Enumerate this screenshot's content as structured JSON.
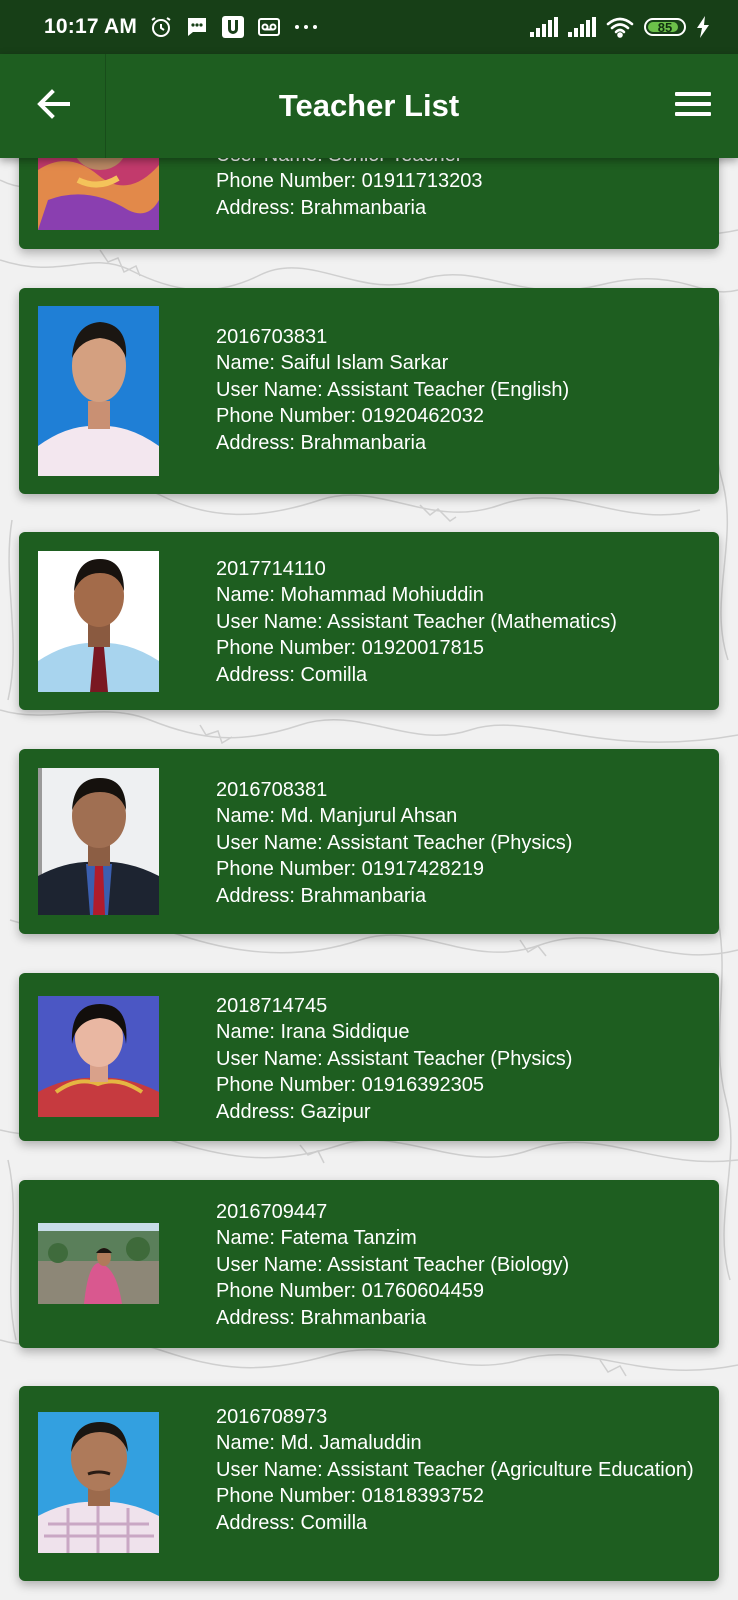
{
  "status_bar": {
    "time": "10:17 AM",
    "battery": "85"
  },
  "app_bar": {
    "title": "Teacher List"
  },
  "teachers": [
    {
      "id": "",
      "name": "",
      "user_name": "User Name: Senior Teacher",
      "phone": "Phone Number: 01911713203",
      "address": "Address: Brahmanbaria"
    },
    {
      "id": "2016703831",
      "name": "Name: Saiful Islam Sarkar",
      "user_name": "User Name: Assistant Teacher (English)",
      "phone": "Phone Number: 01920462032",
      "address": "Address: Brahmanbaria"
    },
    {
      "id": "2017714110",
      "name": "Name: Mohammad Mohiuddin",
      "user_name": "User Name: Assistant Teacher (Mathematics)",
      "phone": "Phone Number: 01920017815",
      "address": "Address: Comilla"
    },
    {
      "id": "2016708381",
      "name": "Name: Md. Manjurul Ahsan",
      "user_name": "User Name: Assistant Teacher (Physics)",
      "phone": "Phone Number: 01917428219",
      "address": "Address: Brahmanbaria"
    },
    {
      "id": "2018714745",
      "name": "Name: Irana Siddique",
      "user_name": "User Name: Assistant Teacher (Physics)",
      "phone": "Phone Number: 01916392305",
      "address": "Address: Gazipur"
    },
    {
      "id": "2016709447",
      "name": "Name: Fatema Tanzim",
      "user_name": "User Name: Assistant Teacher (Biology)",
      "phone": "Phone Number: 01760604459",
      "address": "Address: Brahmanbaria"
    },
    {
      "id": "2016708973",
      "name": "Name: Md. Jamaluddin",
      "user_name": "User Name: Assistant Teacher (Agriculture Education)",
      "phone": "Phone Number: 01818393752",
      "address": "Address: Comilla"
    }
  ],
  "colors": {
    "status_bar": "#173f17",
    "app_bar": "#1e5e20",
    "card": "#1e5e20",
    "text": "#ffffff",
    "background": "#f1f1f1"
  }
}
